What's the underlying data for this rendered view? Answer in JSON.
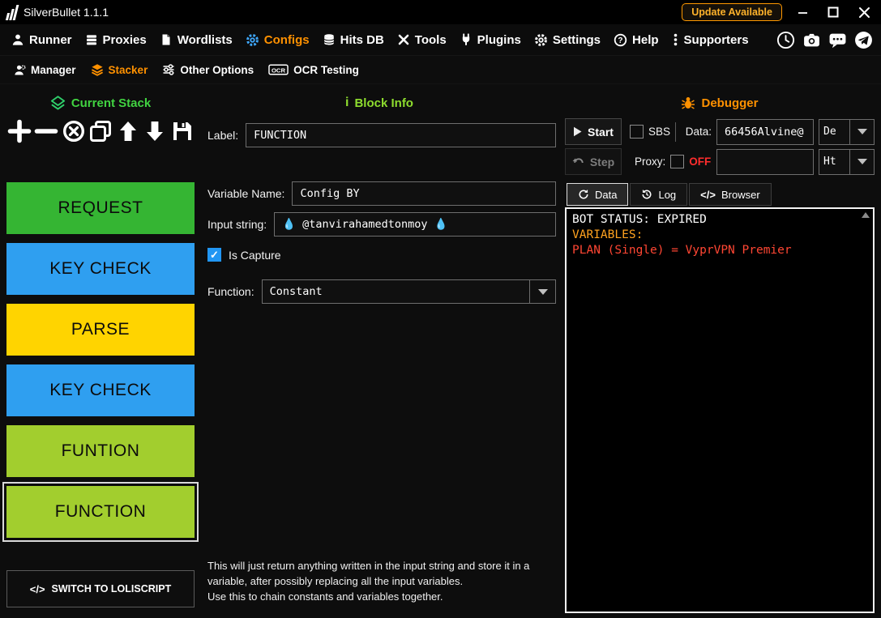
{
  "titlebar": {
    "title": "SilverBullet 1.1.1",
    "update_button": "Update Available"
  },
  "nav": {
    "items": [
      {
        "label": "Runner",
        "icon": "runner-icon"
      },
      {
        "label": "Proxies",
        "icon": "proxies-icon"
      },
      {
        "label": "Wordlists",
        "icon": "wordlists-icon"
      },
      {
        "label": "Configs",
        "icon": "configs-gear-icon",
        "active": true
      },
      {
        "label": "Hits DB",
        "icon": "database-icon"
      },
      {
        "label": "Tools",
        "icon": "tools-icon"
      },
      {
        "label": "Plugins",
        "icon": "plugins-icon"
      },
      {
        "label": "Settings",
        "icon": "settings-gear-icon"
      },
      {
        "label": "Help",
        "icon": "help-icon"
      },
      {
        "label": "Supporters",
        "icon": "supporters-icon"
      }
    ],
    "right_icons": [
      "history-icon",
      "camera-icon",
      "chat-icon",
      "telegram-icon"
    ]
  },
  "subnav": {
    "items": [
      {
        "label": "Manager",
        "icon": "manager-icon"
      },
      {
        "label": "Stacker",
        "icon": "stacker-icon",
        "active": true
      },
      {
        "label": "Other Options",
        "icon": "sliders-icon"
      },
      {
        "label": "OCR Testing",
        "icon": "ocr-icon"
      }
    ]
  },
  "stacker": {
    "section_title": "Current Stack",
    "toolbar_icons": [
      "add-block-icon",
      "remove-block-icon",
      "clear-stack-icon",
      "clone-block-icon",
      "move-up-icon",
      "move-down-icon",
      "save-stack-icon"
    ],
    "blocks": [
      {
        "label": "REQUEST",
        "color": "#35b533"
      },
      {
        "label": "KEY CHECK",
        "color": "#2f9ff0"
      },
      {
        "label": "PARSE",
        "color": "#ffd400"
      },
      {
        "label": "KEY CHECK",
        "color": "#2f9ff0"
      },
      {
        "label": "FUNTION",
        "color": "#a2ce2e"
      },
      {
        "label": "FUNCTION",
        "color": "#a2ce2e",
        "selected": true
      }
    ],
    "switch_icon": "</>",
    "switch_button": "SWITCH TO LOLISCRIPT"
  },
  "block_info": {
    "section_title": "Block Info",
    "label_field": {
      "label": "Label:",
      "value": "FUNCTION"
    },
    "variable_name": {
      "label": "Variable Name:",
      "value": "Config BY"
    },
    "input_string": {
      "label": "Input string:",
      "value": "💧 @tanvirahamedtonmoy 💧"
    },
    "is_capture": {
      "label": "Is Capture",
      "checked": true
    },
    "function": {
      "label": "Function:",
      "value": "Constant"
    },
    "description_line1": "This will just return anything written in the input string and store it in a variable, after possibly replacing all the input variables.",
    "description_line2": "Use this to chain constants and variables together."
  },
  "debugger": {
    "section_title": "Debugger",
    "start_button": "Start",
    "step_button": "Step",
    "sbs_label": "SBS",
    "data_label": "Data:",
    "data_value": "66456Alvine@",
    "data_type_value": "De",
    "proxy_label": "Proxy:",
    "proxy_off": "OFF",
    "proxy_off_color": "#ff2d2d",
    "proxy_value": "",
    "proxy_type_value": "Ht",
    "tabs": [
      {
        "label": "Data",
        "icon": "refresh-icon",
        "active": true
      },
      {
        "label": "Log",
        "icon": "history-icon"
      },
      {
        "label": "Browser",
        "icon": "code-icon"
      }
    ],
    "browser_tab_icon": "</>",
    "console": [
      {
        "text": "BOT STATUS: EXPIRED",
        "color": "#ffffff"
      },
      {
        "text": "VARIABLES:",
        "color": "#ffa21f"
      },
      {
        "text": "PLAN (Single) = VyprVPN Premier",
        "color": "#ff4633"
      }
    ]
  }
}
